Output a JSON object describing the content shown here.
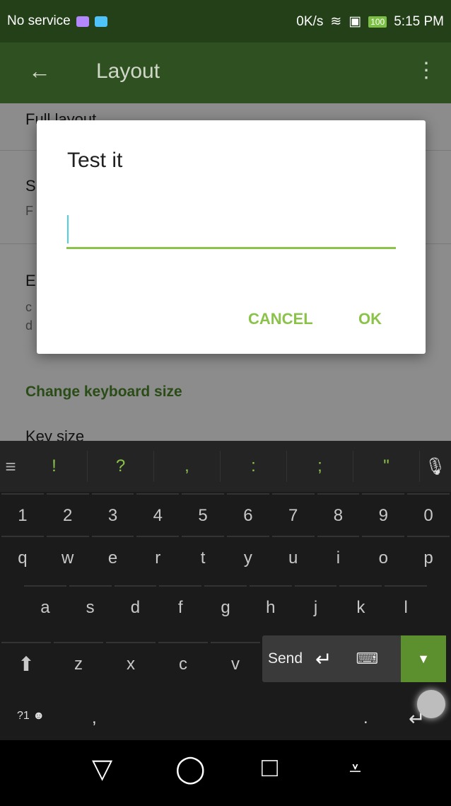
{
  "status_bar": {
    "carrier": "No service",
    "speed": "0K/s",
    "battery": "100",
    "time": "5:15 PM"
  },
  "app_bar": {
    "title": "Layout",
    "back_icon": "arrow-left-icon",
    "more_icon": "more-vert-icon"
  },
  "settings": {
    "partial_row_1": "Full layout",
    "row_2_title": "S",
    "row_2_sub": "F",
    "row_3_title": "E",
    "row_3_sub_1": "c",
    "row_3_sub_2": "d",
    "section_header": "Change keyboard size",
    "partial_row_4": "Key size"
  },
  "dialog": {
    "title": "Test it",
    "input_value": "",
    "cancel_label": "CANCEL",
    "ok_label": "OK"
  },
  "keyboard": {
    "suggestions": [
      "!",
      "?",
      ",",
      ":",
      ";",
      "\""
    ],
    "number_row": [
      "1",
      "2",
      "3",
      "4",
      "5",
      "6",
      "7",
      "8",
      "9",
      "0"
    ],
    "row_1": [
      "q",
      "w",
      "e",
      "r",
      "t",
      "y",
      "u",
      "i",
      "o",
      "p"
    ],
    "row_2": [
      "a",
      "s",
      "d",
      "f",
      "g",
      "h",
      "j",
      "k",
      "l"
    ],
    "row_3": [
      "z",
      "x",
      "c",
      "v"
    ],
    "send_panel": {
      "send_label": "Send"
    },
    "bottom": {
      "symbols_label": "?1",
      "comma": ",",
      "period": "."
    }
  },
  "colors": {
    "accent": "#8bc34a",
    "appbar": "#2f5020",
    "statusbar": "#234018"
  }
}
